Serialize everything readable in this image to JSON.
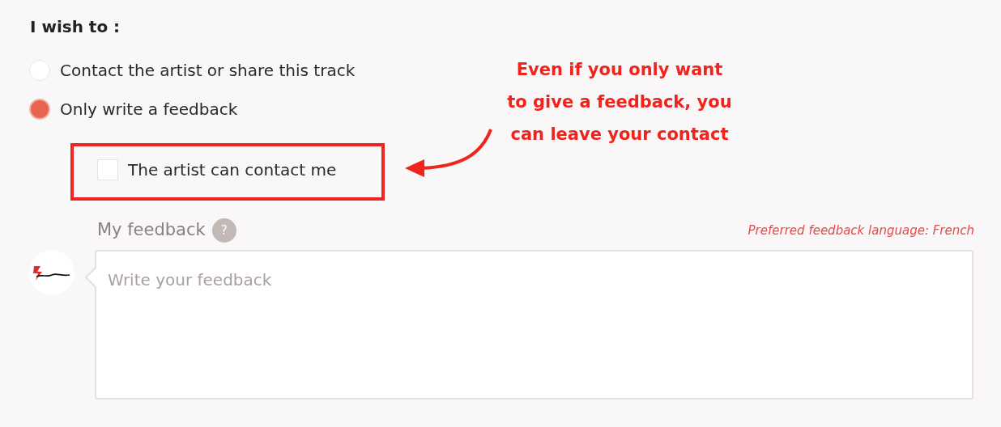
{
  "heading": "I wish to :",
  "options": [
    {
      "label": "Contact the artist or share this track",
      "selected": false
    },
    {
      "label": "Only write a feedback",
      "selected": true
    }
  ],
  "contact_checkbox": {
    "label": "The artist can contact me",
    "checked": false
  },
  "annotation": [
    "Even if you only want",
    "to give a feedback, you",
    "can leave your contact"
  ],
  "feedback": {
    "label": "My feedback",
    "help": "?",
    "language_note": "Preferred feedback language: French",
    "placeholder": "Write your feedback"
  }
}
